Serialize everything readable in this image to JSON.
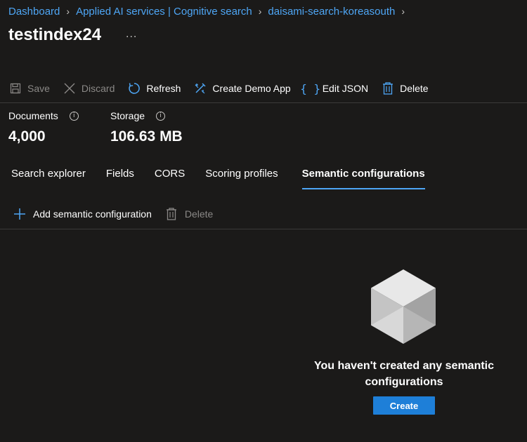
{
  "breadcrumb": {
    "items": [
      "Dashboard",
      "Applied AI services | Cognitive search",
      "daisami-search-koreasouth"
    ]
  },
  "page": {
    "title": "testindex24",
    "more": "..."
  },
  "toolbar": {
    "save": "Save",
    "discard": "Discard",
    "refresh": "Refresh",
    "create_demo_app": "Create Demo App",
    "edit_json": "Edit JSON",
    "delete": "Delete"
  },
  "stats": {
    "documents_label": "Documents",
    "documents_value": "4,000",
    "storage_label": "Storage",
    "storage_value": "106.63 MB"
  },
  "tabs": [
    {
      "label": "Search explorer"
    },
    {
      "label": "Fields"
    },
    {
      "label": "CORS"
    },
    {
      "label": "Scoring profiles"
    },
    {
      "label": "Semantic configurations",
      "active": true
    }
  ],
  "subtoolbar": {
    "add": "Add semantic configuration",
    "delete": "Delete"
  },
  "empty_state": {
    "line1": "You haven't created any semantic",
    "line2": "configurations",
    "create": "Create"
  },
  "colors": {
    "background": "#1b1a19",
    "link": "#4ea6f5",
    "primary_button": "#1e7fd8"
  },
  "icons": [
    "save-icon",
    "discard-icon",
    "refresh-icon",
    "create-demo-app-icon",
    "edit-json-icon",
    "delete-icon",
    "info-icon",
    "add-icon",
    "cube-icon"
  ]
}
